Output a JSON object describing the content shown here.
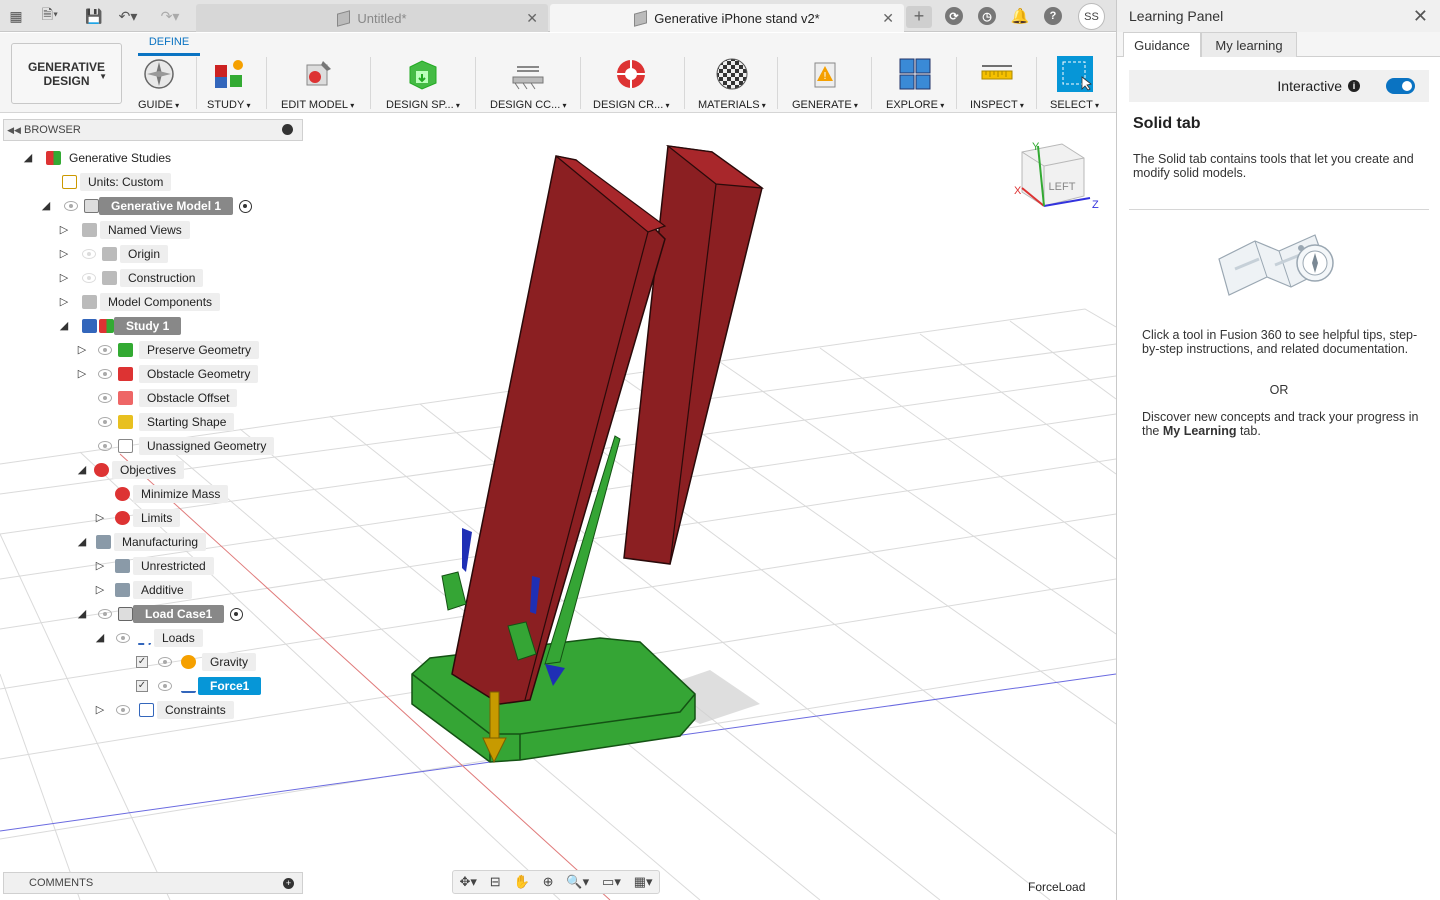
{
  "tabs": {
    "inactive": "Untitled*",
    "active": "Generative iPhone stand v2*"
  },
  "user_initials": "SS",
  "toolbar": {
    "define_tab": "DEFINE",
    "workspace_line1": "GENERATIVE",
    "workspace_line2": "DESIGN",
    "tools": [
      {
        "label": "GUIDE",
        "icon": "guide-compass-icon"
      },
      {
        "label": "STUDY",
        "icon": "study-icon"
      },
      {
        "label": "EDIT MODEL",
        "icon": "edit-model-icon"
      },
      {
        "label": "DESIGN SP...",
        "icon": "design-space-icon"
      },
      {
        "label": "DESIGN CC...",
        "icon": "design-conditions-icon"
      },
      {
        "label": "DESIGN CR...",
        "icon": "design-criteria-icon"
      },
      {
        "label": "MATERIALS",
        "icon": "materials-icon"
      },
      {
        "label": "GENERATE",
        "icon": "generate-icon"
      },
      {
        "label": "EXPLORE",
        "icon": "explore-icon"
      },
      {
        "label": "INSPECT",
        "icon": "inspect-icon"
      },
      {
        "label": "SELECT",
        "icon": "select-icon"
      }
    ]
  },
  "browser": {
    "title": "BROWSER",
    "items": [
      {
        "label": "Generative Studies"
      },
      {
        "label": "Units: Custom"
      },
      {
        "label": "Generative Model 1"
      },
      {
        "label": "Named Views"
      },
      {
        "label": "Origin"
      },
      {
        "label": "Construction"
      },
      {
        "label": "Model Components"
      },
      {
        "label": "Study 1"
      },
      {
        "label": "Preserve Geometry"
      },
      {
        "label": "Obstacle Geometry"
      },
      {
        "label": "Obstacle Offset"
      },
      {
        "label": "Starting Shape"
      },
      {
        "label": "Unassigned Geometry"
      },
      {
        "label": "Objectives"
      },
      {
        "label": "Minimize Mass"
      },
      {
        "label": "Limits"
      },
      {
        "label": "Manufacturing"
      },
      {
        "label": "Unrestricted"
      },
      {
        "label": "Additive"
      },
      {
        "label": "Load Case1"
      },
      {
        "label": "Loads"
      },
      {
        "label": "Gravity"
      },
      {
        "label": "Force1"
      },
      {
        "label": "Constraints"
      }
    ]
  },
  "comments_label": "COMMENTS",
  "viewport": {
    "viewcube_face": "LEFT",
    "axis_x": "X",
    "axis_y": "Y",
    "axis_z": "Z",
    "status_text": "ForceLoad"
  },
  "learning_panel": {
    "title": "Learning Panel",
    "tab_guidance": "Guidance",
    "tab_my_learning": "My learning",
    "interactive_label": "Interactive",
    "heading": "Solid tab",
    "description": "The Solid tab contains tools that let you create and modify solid models.",
    "para1": "Click a tool in Fusion 360 to see helpful tips, step-by-step instructions, and related documentation.",
    "or_text": "OR",
    "para2_prefix": "Discover new concepts and track your progress in the ",
    "para2_bold": "My Learning",
    "para2_suffix": " tab."
  },
  "colors": {
    "accent": "#0a73c2",
    "selected": "#0696d7",
    "model_red": "#8b1f22",
    "model_green": "#35a535",
    "force_arrow": "#c79a00"
  }
}
